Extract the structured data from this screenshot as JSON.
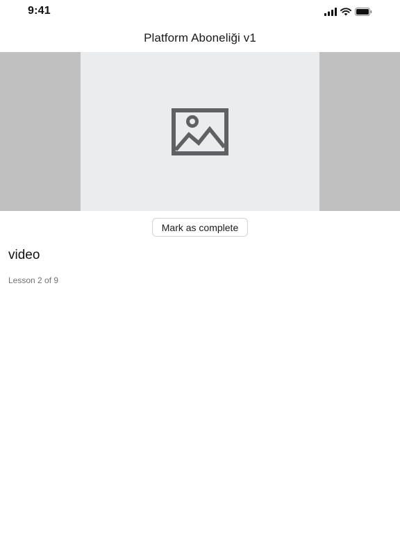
{
  "status_bar": {
    "time": "9:41",
    "icons": [
      "signal-icon",
      "wifi-icon",
      "battery-icon"
    ]
  },
  "nav": {
    "title": "Platform Aboneliği v1"
  },
  "media": {
    "placeholder_icon": "image-placeholder-icon",
    "colors": {
      "letterbox": "#c0c0c0",
      "frame": "#ebecee",
      "icon": "#5f6165"
    }
  },
  "actions": {
    "mark_complete_label": "Mark as complete"
  },
  "lesson": {
    "title": "video",
    "progress": "Lesson 2 of 9"
  }
}
